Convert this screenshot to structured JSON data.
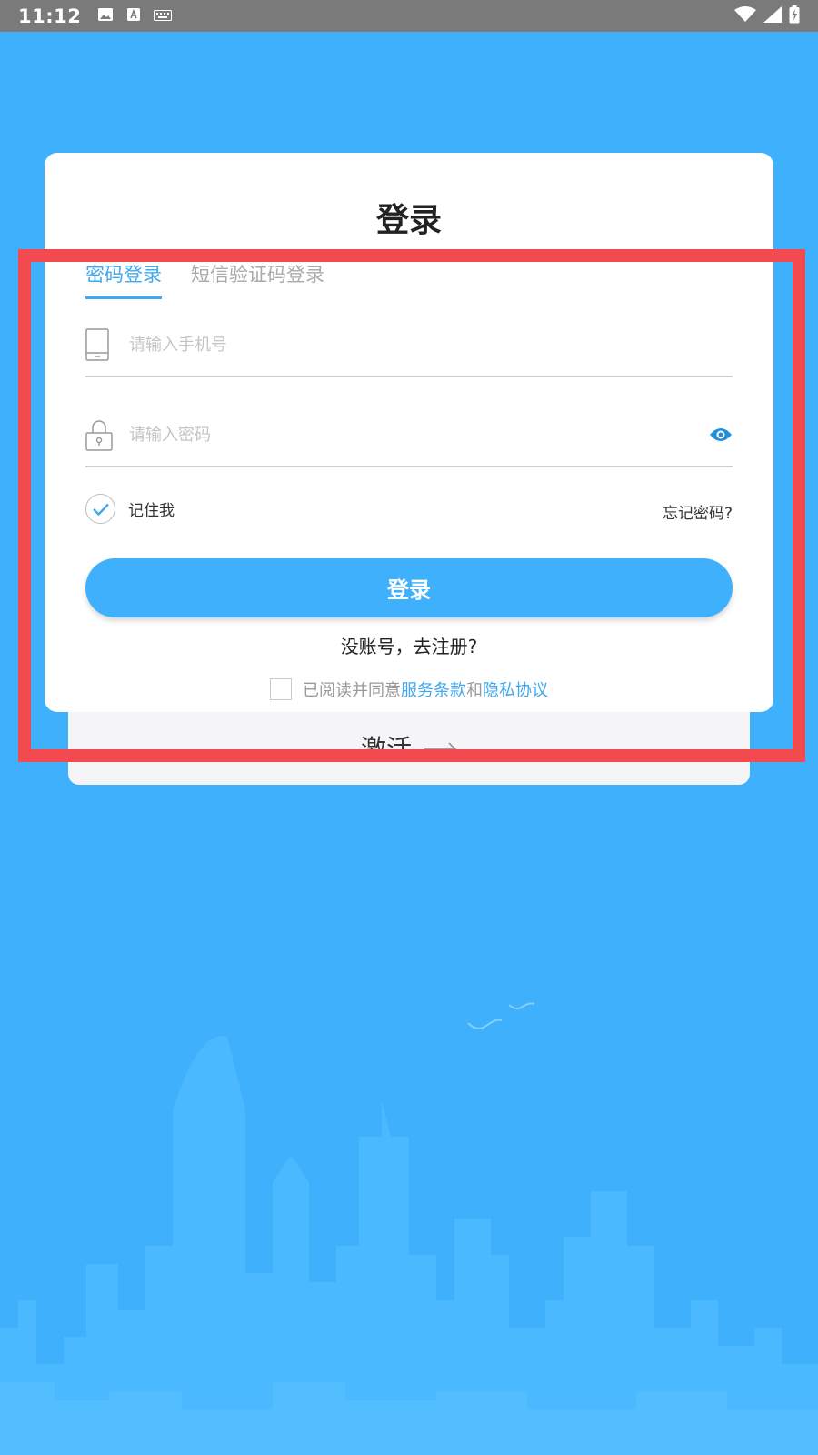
{
  "status_bar": {
    "time": "11:12",
    "icons": [
      "image-icon",
      "text-a-icon",
      "keyboard-icon",
      "wifi-icon",
      "signal-icon",
      "battery-icon"
    ]
  },
  "card": {
    "title": "登录",
    "tabs": [
      {
        "label": "密码登录",
        "active": true
      },
      {
        "label": "短信验证码登录",
        "active": false
      }
    ],
    "phone_placeholder": "请输入手机号",
    "password_placeholder": "请输入密码",
    "remember_label": "记住我",
    "remember_checked": true,
    "forgot_label": "忘记密码?",
    "login_button": "登录",
    "register_link": "没账号，去注册?",
    "agree": {
      "checked": false,
      "prefix": "已阅读并同意",
      "terms": "服务条款",
      "and": "和",
      "privacy": "隐私协议"
    }
  },
  "back_card": {
    "activate_label": "激活"
  },
  "colors": {
    "background": "#3fb0fb",
    "accent": "#3fa8ee",
    "highlight": "#f24a4f"
  }
}
